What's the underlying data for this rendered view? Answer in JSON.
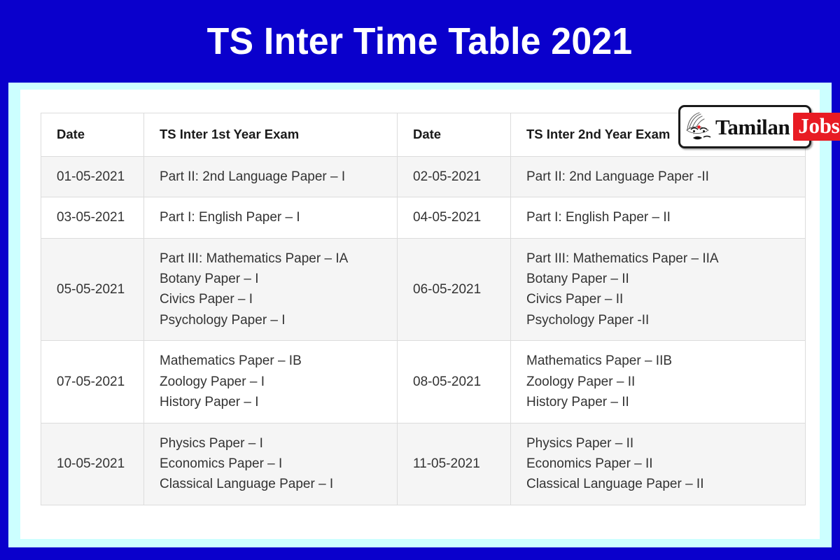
{
  "banner": {
    "title": "TS Inter Time Table 2021",
    "background_color": "#0A00CC",
    "text_color": "#FFFFFF"
  },
  "frame": {
    "cyan_color": "#CCFFFF",
    "content_background": "#FFFFFF"
  },
  "logo": {
    "name": "tamilan-jobs-logo",
    "word": "Tamilan",
    "badge": "Jobs",
    "badge_color": "#E81B23",
    "icon": "face-icon"
  },
  "table": {
    "headers": [
      "Date",
      "TS Inter 1st Year Exam",
      "Date",
      "TS Inter 2nd Year Exam"
    ],
    "rows": [
      {
        "date1": "01-05-2021",
        "exam1": [
          "Part II: 2nd Language Paper – I"
        ],
        "date2": "02-05-2021",
        "exam2": [
          "Part II: 2nd Language Paper -II"
        ]
      },
      {
        "date1": "03-05-2021",
        "exam1": [
          "Part I: English Paper – I"
        ],
        "date2": "04-05-2021",
        "exam2": [
          "Part I: English Paper – II"
        ]
      },
      {
        "date1": "05-05-2021",
        "exam1": [
          "Part III: Mathematics Paper – IA",
          "Botany Paper – I",
          "Civics Paper – I",
          "Psychology Paper – I"
        ],
        "date2": "06-05-2021",
        "exam2": [
          "Part III: Mathematics Paper – IIA",
          "Botany Paper – II",
          "Civics Paper – II",
          "Psychology Paper -II"
        ]
      },
      {
        "date1": "07-05-2021",
        "exam1": [
          "Mathematics Paper – IB",
          "Zoology Paper – I",
          "History Paper –  I"
        ],
        "date2": "08-05-2021",
        "exam2": [
          "Mathematics Paper – IIB",
          "Zoology Paper – II",
          "History Paper –  II"
        ]
      },
      {
        "date1": "10-05-2021",
        "exam1": [
          "Physics Paper – I",
          "Economics Paper – I",
          "Classical Language Paper – I"
        ],
        "date2": "11-05-2021",
        "exam2": [
          "Physics Paper – II",
          "Economics Paper – II",
          "Classical Language Paper – II"
        ]
      }
    ]
  }
}
